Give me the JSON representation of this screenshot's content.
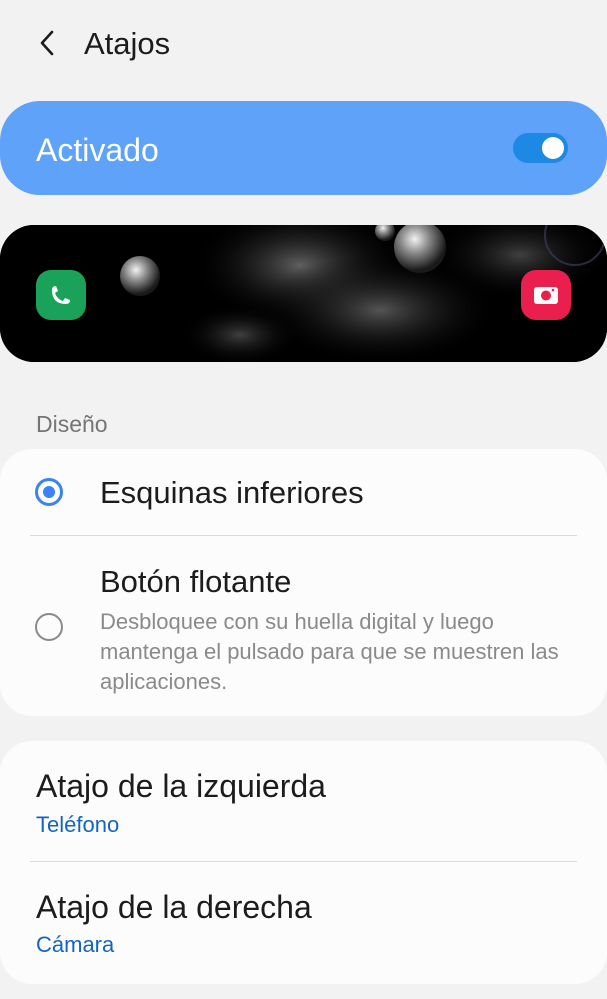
{
  "header": {
    "title": "Atajos"
  },
  "master_switch": {
    "label": "Activado",
    "on": true
  },
  "preview": {
    "left_shortcut_icon": "phone-icon",
    "right_shortcut_icon": "camera-icon",
    "left_color": "#1aa15a",
    "right_color": "#ea1f4e"
  },
  "design_section": {
    "label": "Diseño",
    "options": [
      {
        "title": "Esquinas inferiores",
        "selected": true
      },
      {
        "title": "Botón flotante",
        "selected": false,
        "description": "Desbloquee con su huella digital y luego mantenga el pulsado para que se muestren las aplicaciones."
      }
    ]
  },
  "shortcuts": [
    {
      "title": "Atajo de la izquierda",
      "value": "Teléfono"
    },
    {
      "title": "Atajo de la derecha",
      "value": "Cámara"
    }
  ],
  "colors": {
    "accent": "#3b82f6",
    "master_bg": "#5ea2f9",
    "link": "#1565c0"
  }
}
